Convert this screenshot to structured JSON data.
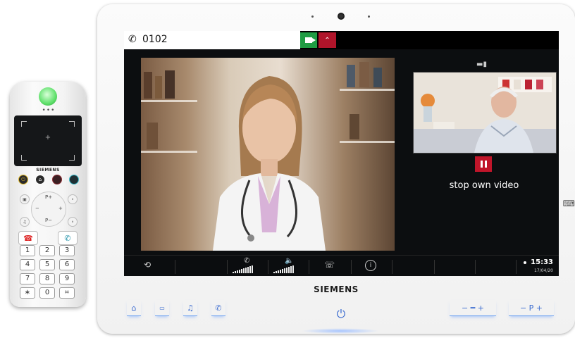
{
  "remote": {
    "brand": "SIEMENS",
    "nav_labels": {
      "up": "P+",
      "down": "P−",
      "left": "−",
      "right": "+"
    },
    "keys": [
      "1",
      "2",
      "3",
      "4",
      "5",
      "6",
      "7",
      "8",
      "9",
      "∗",
      "0",
      "⌗"
    ]
  },
  "call": {
    "number": "0102"
  },
  "self_view": {
    "stop_label": "stop own video"
  },
  "status": {
    "time": "15:33",
    "date": "17/04/20"
  },
  "terminal": {
    "brand": "SIEMENS",
    "buttons": {
      "left": [
        "home-icon",
        "tv-icon",
        "music-icon",
        "phone-icon"
      ],
      "volume": "−  ━  +",
      "program": "−  P  +"
    }
  },
  "colors": {
    "accent_green": "#1f9c43",
    "accent_red": "#b0142a",
    "hw_button_blue": "#3a6bd0"
  }
}
